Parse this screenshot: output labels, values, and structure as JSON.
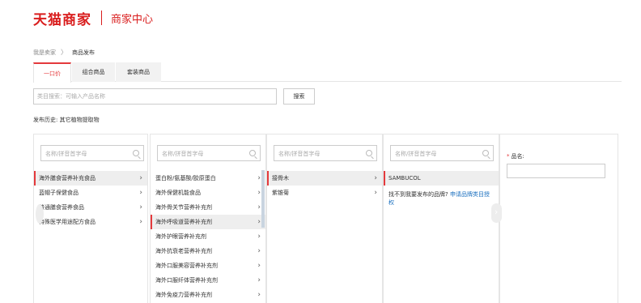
{
  "header": {
    "brand": "天猫商家",
    "subtitle": "商家中心"
  },
  "breadcrumb": {
    "root": "我是卖家",
    "separator": "〉",
    "current": "商品发布"
  },
  "tabs": [
    {
      "label": "一口价",
      "active": true
    },
    {
      "label": "组合商品",
      "active": false
    },
    {
      "label": "套装商品",
      "active": false
    }
  ],
  "category_search": {
    "placeholder": "类目搜索：可输入产品名称",
    "button_label": "搜索"
  },
  "history": {
    "text": "发布历史: 其它植物提取物"
  },
  "columns": {
    "search_placeholder": "名称/拼音首字母",
    "col1": {
      "items": [
        "海外膳食营养补充食品",
        "蓝帽子保健食品",
        "普通膳食营养食品",
        "特殊医学用途配方食品"
      ]
    },
    "col2": {
      "items": [
        "蛋白粉/氨基酸/胶原蛋白",
        "海外保健机能食品",
        "海外骨关节营养补充剂",
        "海外呼吸道营养补充剂",
        "海外护眼营养补充剂",
        "海外抗衰老营养补充剂",
        "海外口服美容营养补充剂",
        "海外口服纤体营养补充剂",
        "海外免疫力营养补充剂"
      ]
    },
    "col3": {
      "items": [
        "接骨木",
        "紫锥菊"
      ]
    },
    "col4": {
      "brand": "SAMBUCOL",
      "not_found_text": "找不到我要发布的品牌?",
      "apply_link": "申请品牌类目授权"
    }
  },
  "product_name": {
    "required_mark": "*",
    "label": "品名:",
    "value": ""
  },
  "colors": {
    "accent": "#e4393c",
    "brand": "#d91d1d",
    "link": "#1a6fbf"
  }
}
